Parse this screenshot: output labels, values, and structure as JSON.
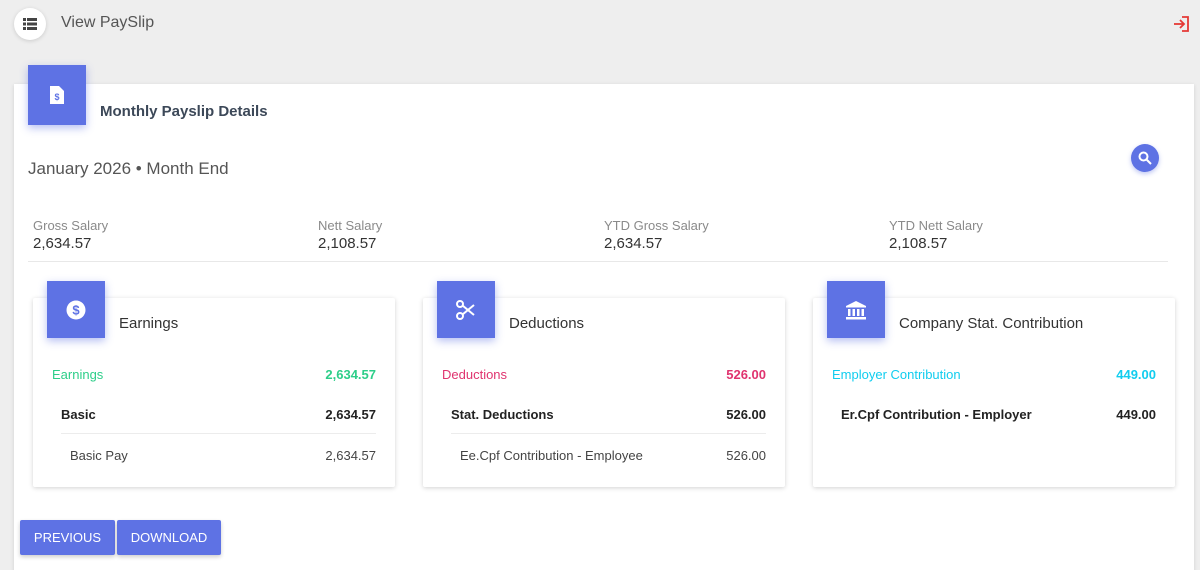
{
  "header": {
    "title": "View PaySlip",
    "menu_icon": "list-icon",
    "logout_icon": "logout-icon"
  },
  "card": {
    "title": "Monthly Payslip Details",
    "icon": "payslip-document-icon",
    "period": "January 2026 • Month End"
  },
  "summary": [
    {
      "label": "Gross Salary",
      "value": "2,634.57"
    },
    {
      "label": "Nett Salary",
      "value": "2,108.57"
    },
    {
      "label": "YTD Gross Salary",
      "value": "2,634.57"
    },
    {
      "label": "YTD Nett Salary",
      "value": "2,108.57"
    }
  ],
  "earnings": {
    "title": "Earnings",
    "icon": "dollar-icon",
    "section_label": "Earnings",
    "section_value": "2,634.57",
    "group_label": "Basic",
    "group_value": "2,634.57",
    "item_label": "Basic Pay",
    "item_value": "2,634.57"
  },
  "deductions": {
    "title": "Deductions",
    "icon": "scissors-icon",
    "section_label": "Deductions",
    "section_value": "526.00",
    "group_label": "Stat. Deductions",
    "group_value": "526.00",
    "item_label": "Ee.Cpf Contribution - Employee",
    "item_value": "526.00"
  },
  "company": {
    "title": "Company Stat. Contribution",
    "icon": "bank-icon",
    "section_label": "Employer Contribution",
    "section_value": "449.00",
    "group_label": "Er.Cpf Contribution - Employer",
    "group_value": "449.00"
  },
  "buttons": {
    "previous": "PREVIOUS",
    "download": "DOWNLOAD"
  },
  "colors": {
    "accent": "#5e72e4",
    "earnings_green": "#2dce89",
    "deductions_pink": "#e0336f",
    "employer_cyan": "#11cdef"
  }
}
